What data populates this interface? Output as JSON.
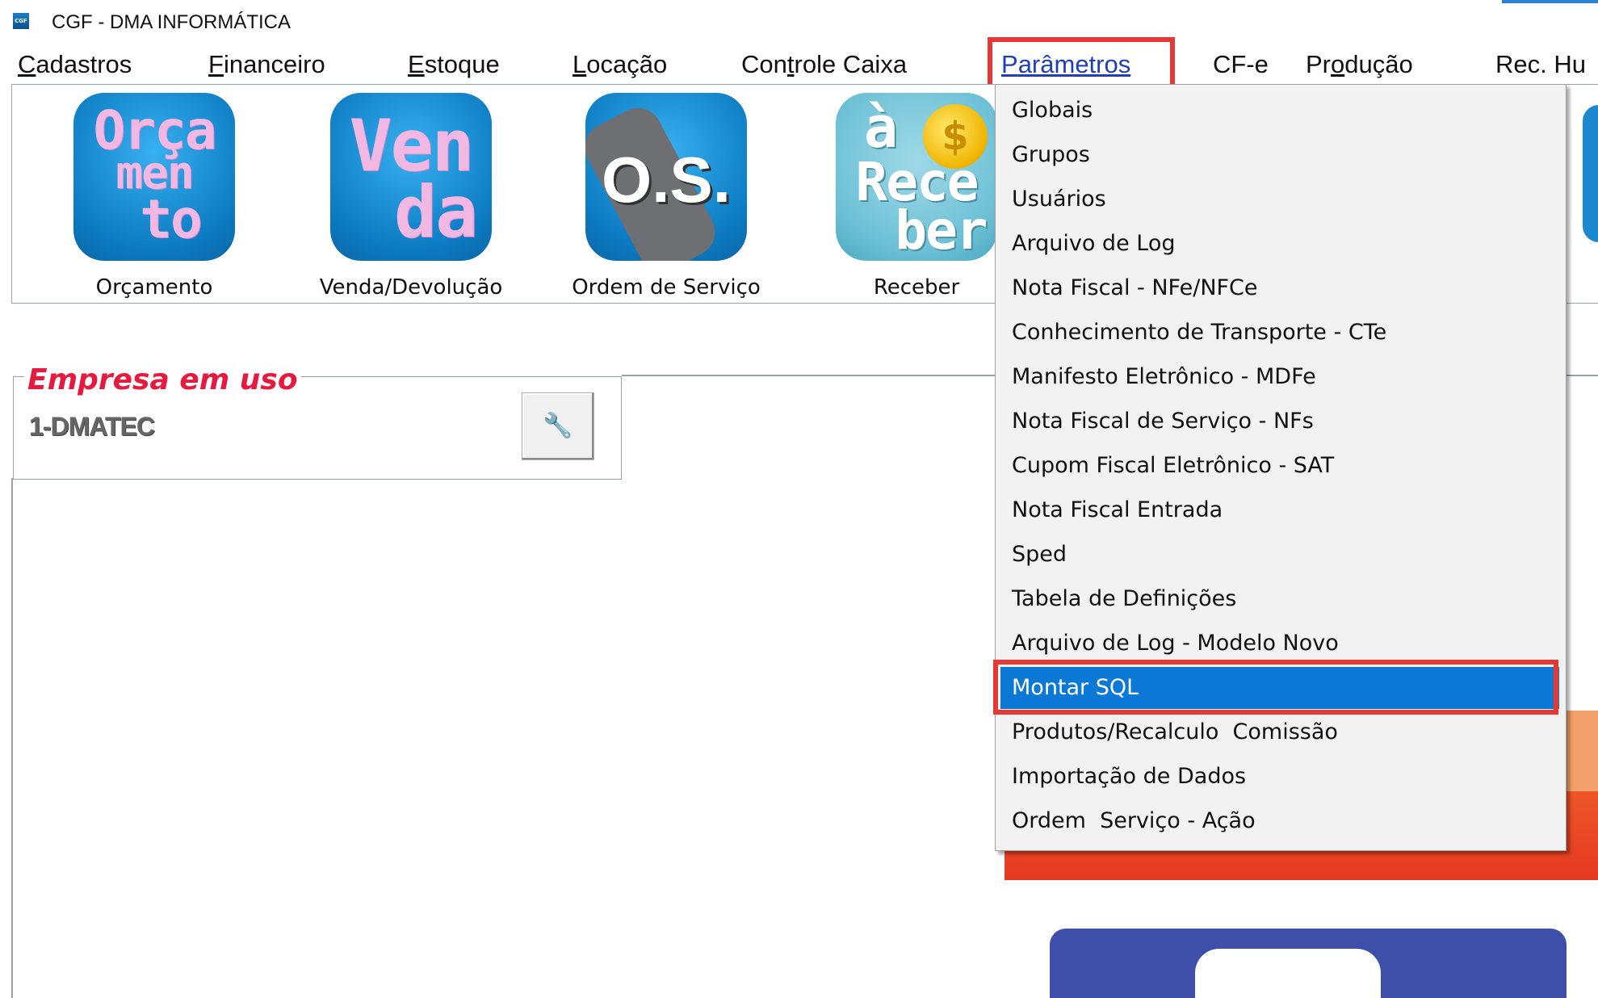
{
  "window": {
    "title": "CGF - DMA INFORMÁTICA",
    "icon": "cgf-app-icon"
  },
  "menubar": {
    "items": [
      {
        "pre": "",
        "u": "C",
        "post": "adastros"
      },
      {
        "pre": "",
        "u": "F",
        "post": "inanceiro"
      },
      {
        "pre": "",
        "u": "E",
        "post": "stoque"
      },
      {
        "pre": "",
        "u": "L",
        "post": "ocação"
      },
      {
        "pre": "Con",
        "u": "t",
        "post": "role Caixa"
      },
      {
        "pre": "",
        "u": "P",
        "post": "arâmetros"
      },
      {
        "pre": "CF-e",
        "u": "",
        "post": ""
      },
      {
        "pre": "Pr",
        "u": "o",
        "post": "dução"
      },
      {
        "pre": "Rec. Hu",
        "u": "",
        "post": ""
      }
    ],
    "active_index": 5
  },
  "toolbar": {
    "tools": [
      {
        "label": "Orçamento",
        "icon": "orcamento-icon",
        "lines": [
          "Orça",
          "men",
          "to"
        ]
      },
      {
        "label": "Venda/Devolução",
        "icon": "venda-icon",
        "lines": [
          "Ven",
          "da"
        ]
      },
      {
        "label": "Ordem de Serviço",
        "icon": "ordem-servico-icon",
        "text": "O.S."
      },
      {
        "label": "Receber",
        "icon": "receber-icon",
        "lines": [
          "à",
          "Rece",
          "ber"
        ],
        "coin": "$"
      }
    ]
  },
  "company": {
    "legend": "Empresa em uso",
    "name": "1-DMATEC",
    "switch_icon": "change-company-icon"
  },
  "dropdown": {
    "items": [
      "Globais",
      "Grupos",
      "Usuários",
      "Arquivo de Log",
      "Nota Fiscal - NFe/NFCe",
      "Conhecimento de Transporte - CTe",
      "Manifesto Eletrônico - MDFe",
      "Nota Fiscal de Serviço - NFs",
      "Cupom Fiscal Eletrônico - SAT",
      "Nota Fiscal Entrada",
      "Sped",
      "Tabela de Definições",
      "Arquivo de Log - Modelo Novo",
      "Montar SQL",
      "Produtos/Recalculo  Comissão",
      "Importação de Dados",
      "Ordem  Serviço - Ação"
    ],
    "selected_index": 13
  },
  "colors": {
    "highlight": "#e53935",
    "selection": "#0a78d4",
    "legend": "#e8193e"
  }
}
